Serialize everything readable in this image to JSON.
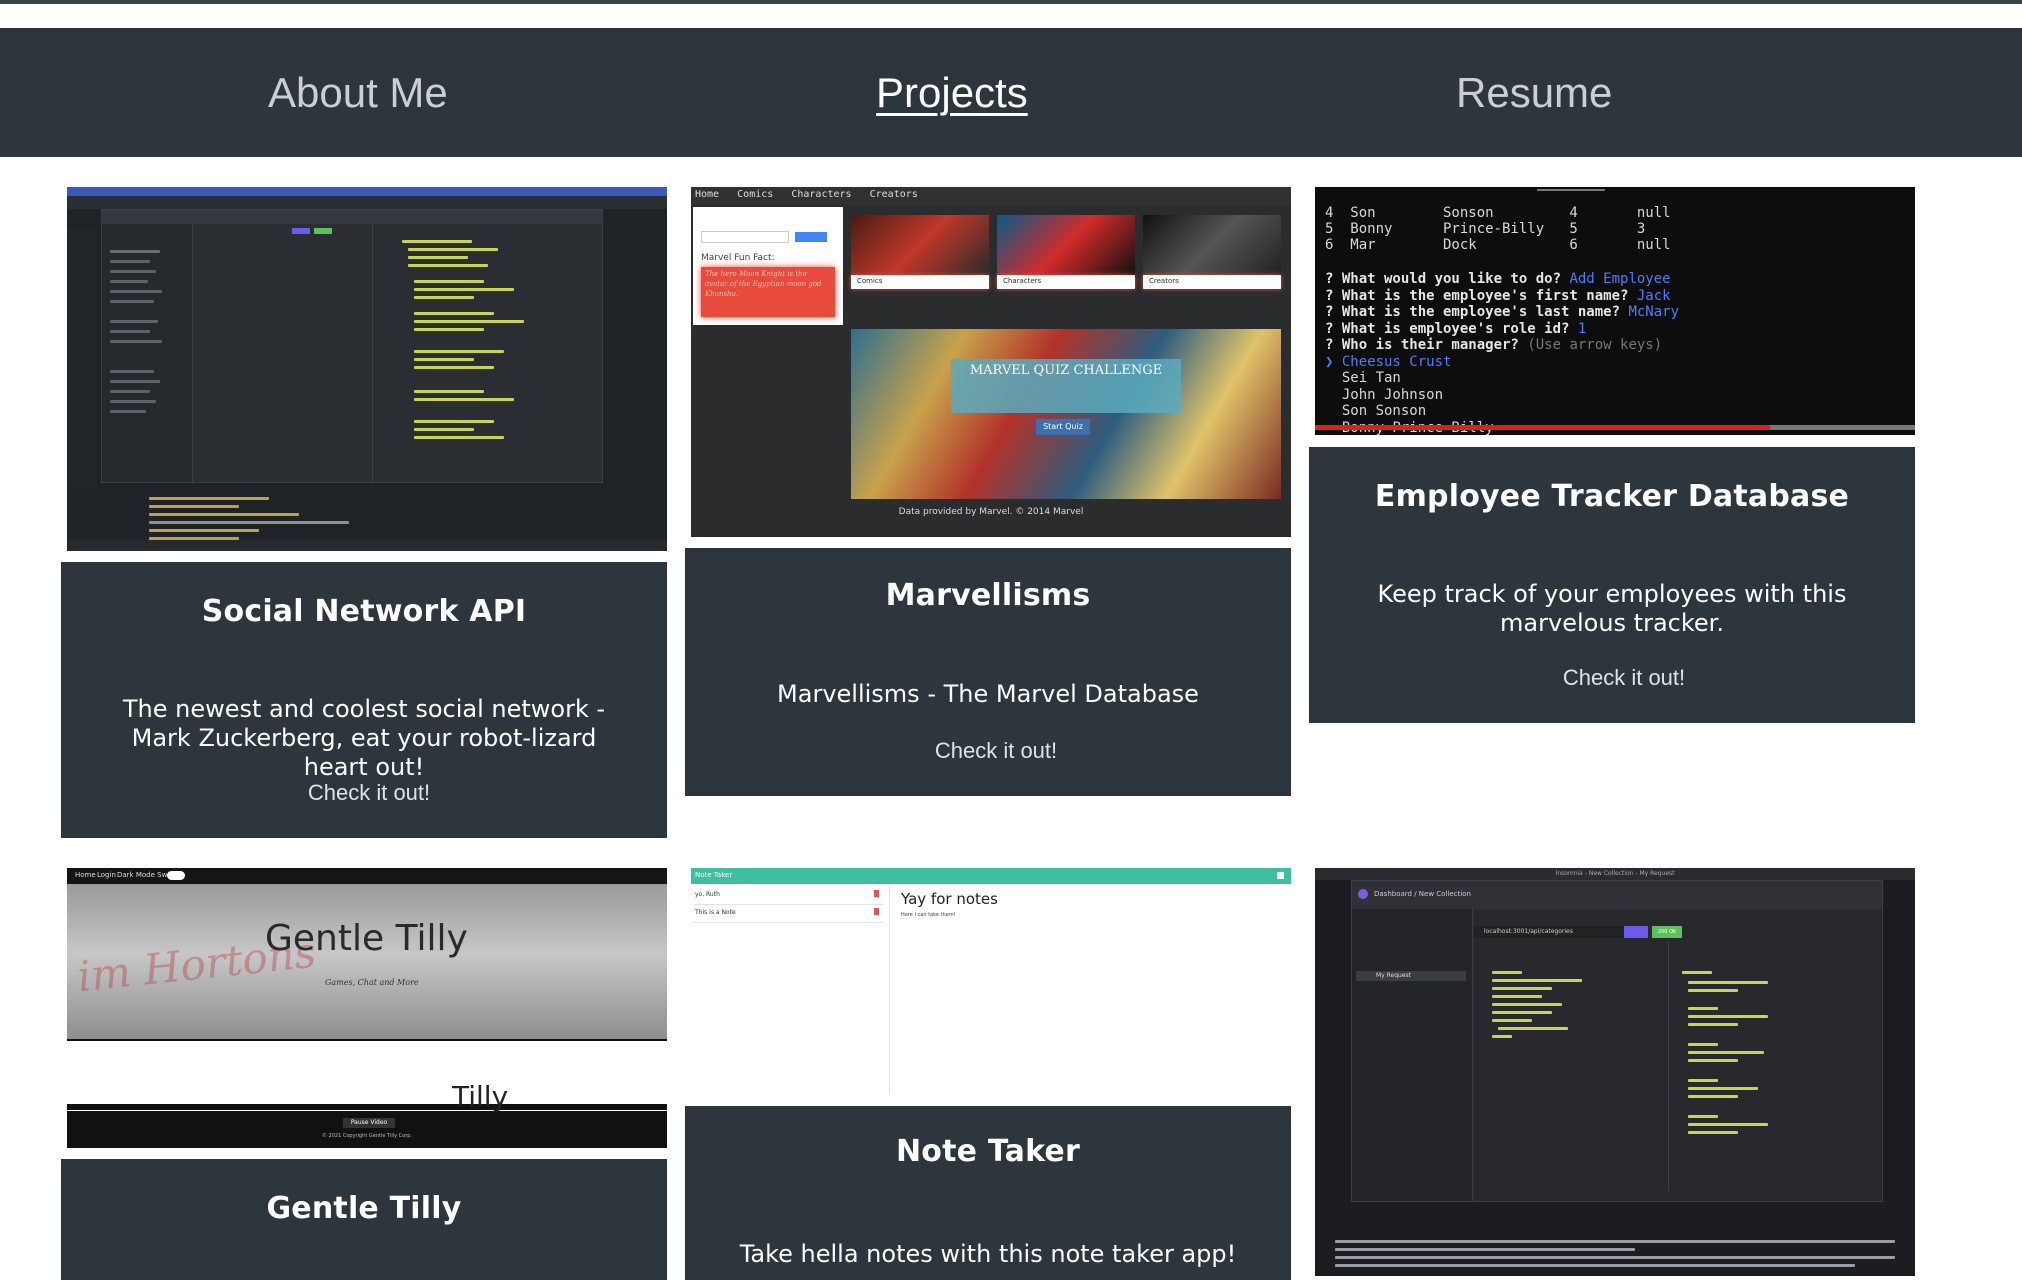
{
  "nav": {
    "about": "About Me",
    "projects": "Projects",
    "resume": "Resume"
  },
  "projects": [
    {
      "title": "Social Network API",
      "description": "The newest and coolest social network - Mark Zuckerberg, eat your robot-lizard heart out!",
      "link": "Check it out!"
    },
    {
      "title": "Marvellisms",
      "description": "Marvellisms - The Marvel Database",
      "link": "Check it out!",
      "preview": {
        "nav": [
          "Home",
          "Comics",
          "Characters",
          "Creators"
        ],
        "fun_fact_label": "Marvel Fun Fact:",
        "fun_fact": "The hero Moon Knight is the avatar of the Egyptian moon god Khonshu.",
        "tiles": [
          "Comics",
          "Characters",
          "Creators"
        ],
        "quiz_title": "MARVEL QUIZ CHALLENGE",
        "quiz_button": "Start Quiz",
        "footer": "Data provided by Marvel. © 2014 Marvel"
      }
    },
    {
      "title": "Employee Tracker Database",
      "description": "Keep track of your employees with this marvelous tracker.",
      "link": "Check it out!",
      "preview": {
        "table_rows": [
          [
            "4",
            "Son",
            "Sonson",
            "4",
            "null"
          ],
          [
            "5",
            "Bonny",
            "Prince-Billy",
            "5",
            "3"
          ],
          [
            "6",
            "Mar",
            "Dock",
            "6",
            "null"
          ]
        ],
        "prompts": [
          {
            "q": "? What would you like to do?",
            "a": "Add Employee"
          },
          {
            "q": "? What is the employee's first name?",
            "a": "Jack"
          },
          {
            "q": "? What is the employee's last name?",
            "a": "McNary"
          },
          {
            "q": "? What is employee's role id?",
            "a": "1"
          },
          {
            "q": "? Who is their manager?",
            "a": "(Use arrow keys)"
          }
        ],
        "choices": [
          "Cheesus Crust",
          "Sei Tan",
          "John Johnson",
          "Son Sonson",
          "Bonny Prince-Billy"
        ]
      }
    },
    {
      "title": "Gentle Tilly",
      "description": "",
      "link": "",
      "preview": {
        "nav": [
          "Home",
          "Login",
          "Dark Mode Switch"
        ],
        "hero_title": "Gentle Tilly",
        "hero_subtitle": "Games, Chat and More",
        "lower_title": "Tilly",
        "button": "Pause Video",
        "footer": "© 2021 Copyright Gentle Tilly Corp."
      }
    },
    {
      "title": "Note Taker",
      "description": "Take hella notes with this note taker app!",
      "link": "",
      "preview": {
        "app_name": "Note Taker",
        "notes": [
          "yo, Ruth",
          "This is a Note"
        ],
        "note_title": "Yay for notes",
        "note_body": "Here I can take them!"
      }
    },
    {
      "title": "",
      "description": "",
      "link": "",
      "preview": {
        "window_title": "Insomnia - New Collection - My Request",
        "breadcrumb": "Dashboard / New Collection",
        "request": "My Request",
        "url": "localhost:3001/api/categories",
        "status": "200 OK"
      }
    }
  ],
  "colors": {
    "navbar": "#2d363c",
    "card": "#2d363c",
    "card_text": "#ffffff",
    "nav_text": "#cbcfd1",
    "note_taker_accent": "#3ebfa0",
    "marvel_red": "#e84b3c",
    "terminal_bg": "#0d0d0d"
  }
}
